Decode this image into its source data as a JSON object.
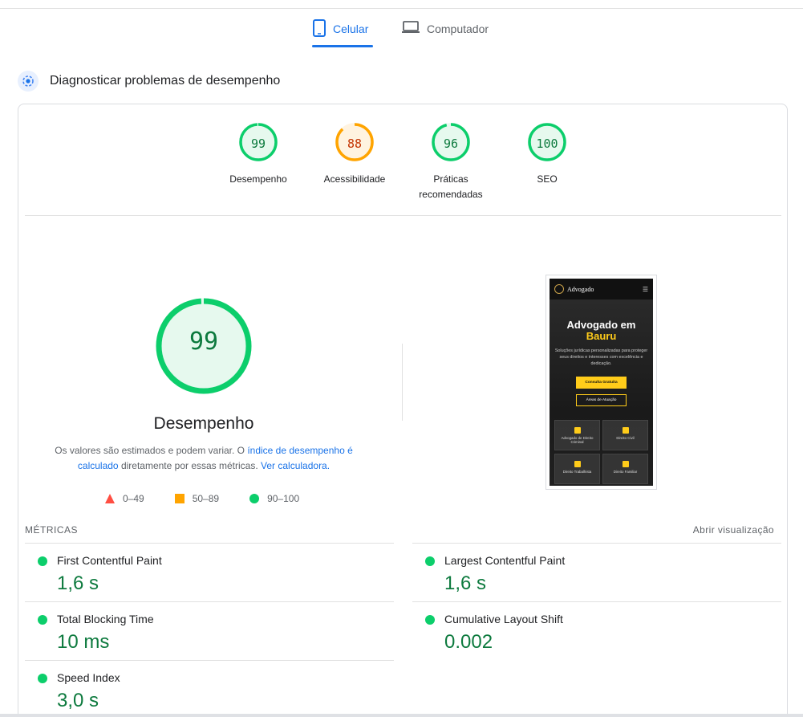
{
  "tabs": [
    {
      "label": "Celular",
      "active": true,
      "icon": "phone-icon"
    },
    {
      "label": "Computador",
      "active": false,
      "icon": "laptop-icon"
    }
  ],
  "diagnose": {
    "title": "Diagnosticar problemas de desempenho",
    "icon": "gauge-icon"
  },
  "categories": [
    {
      "score": "99",
      "label": "Desempenho",
      "fraction": 0.99,
      "color": "#0cce6b",
      "bg": "#e6f9ee",
      "text": "#0d7a3e"
    },
    {
      "score": "88",
      "label": "Acessibilidade",
      "fraction": 0.88,
      "color": "#ffa400",
      "bg": "#fff3e0",
      "text": "#c33300"
    },
    {
      "score": "96",
      "label": "Práticas recomendadas",
      "fraction": 0.96,
      "color": "#0cce6b",
      "bg": "#e6f9ee",
      "text": "#0d7a3e"
    },
    {
      "score": "100",
      "label": "SEO",
      "fraction": 1.0,
      "color": "#0cce6b",
      "bg": "#e6f9ee",
      "text": "#0d7a3e"
    }
  ],
  "performance": {
    "score": "99",
    "fraction": 0.99,
    "title": "Desempenho",
    "desc_1": "Os valores são estimados e podem variar. O ",
    "link_1": "índice de desempenho é calculado",
    "desc_2": " diretamente por essas métricas. ",
    "link_2": "Ver calculadora."
  },
  "legend": [
    {
      "range": "0–49",
      "shape": "triangle",
      "color": "#ff4e42"
    },
    {
      "range": "50–89",
      "shape": "square",
      "color": "#ffa400"
    },
    {
      "range": "90–100",
      "shape": "circle",
      "color": "#0cce6b"
    }
  ],
  "screenshot": {
    "brand": "Advogado",
    "hero_line1": "Advogado em",
    "hero_line2": "Bauru",
    "hero_text": "Soluções jurídicas personalizadas para proteger seus direitos e interesses com excelência e dedicação.",
    "btn_primary": "Consulta Gratuita",
    "btn_secondary": "Áreas de Atuação",
    "cards": [
      "Advogado de Direito Criminal",
      "Direito Civil",
      "Direito Trabalhista",
      "Direito Familiar"
    ]
  },
  "metrics": {
    "heading": "MÉTRICAS",
    "open_view": "Abrir visualização",
    "items": [
      {
        "name": "First Contentful Paint",
        "value": "1,6 s"
      },
      {
        "name": "Largest Contentful Paint",
        "value": "1,6 s"
      },
      {
        "name": "Total Blocking Time",
        "value": "10 ms"
      },
      {
        "name": "Cumulative Layout Shift",
        "value": "0.002"
      },
      {
        "name": "Speed Index",
        "value": "3,0 s"
      }
    ]
  }
}
